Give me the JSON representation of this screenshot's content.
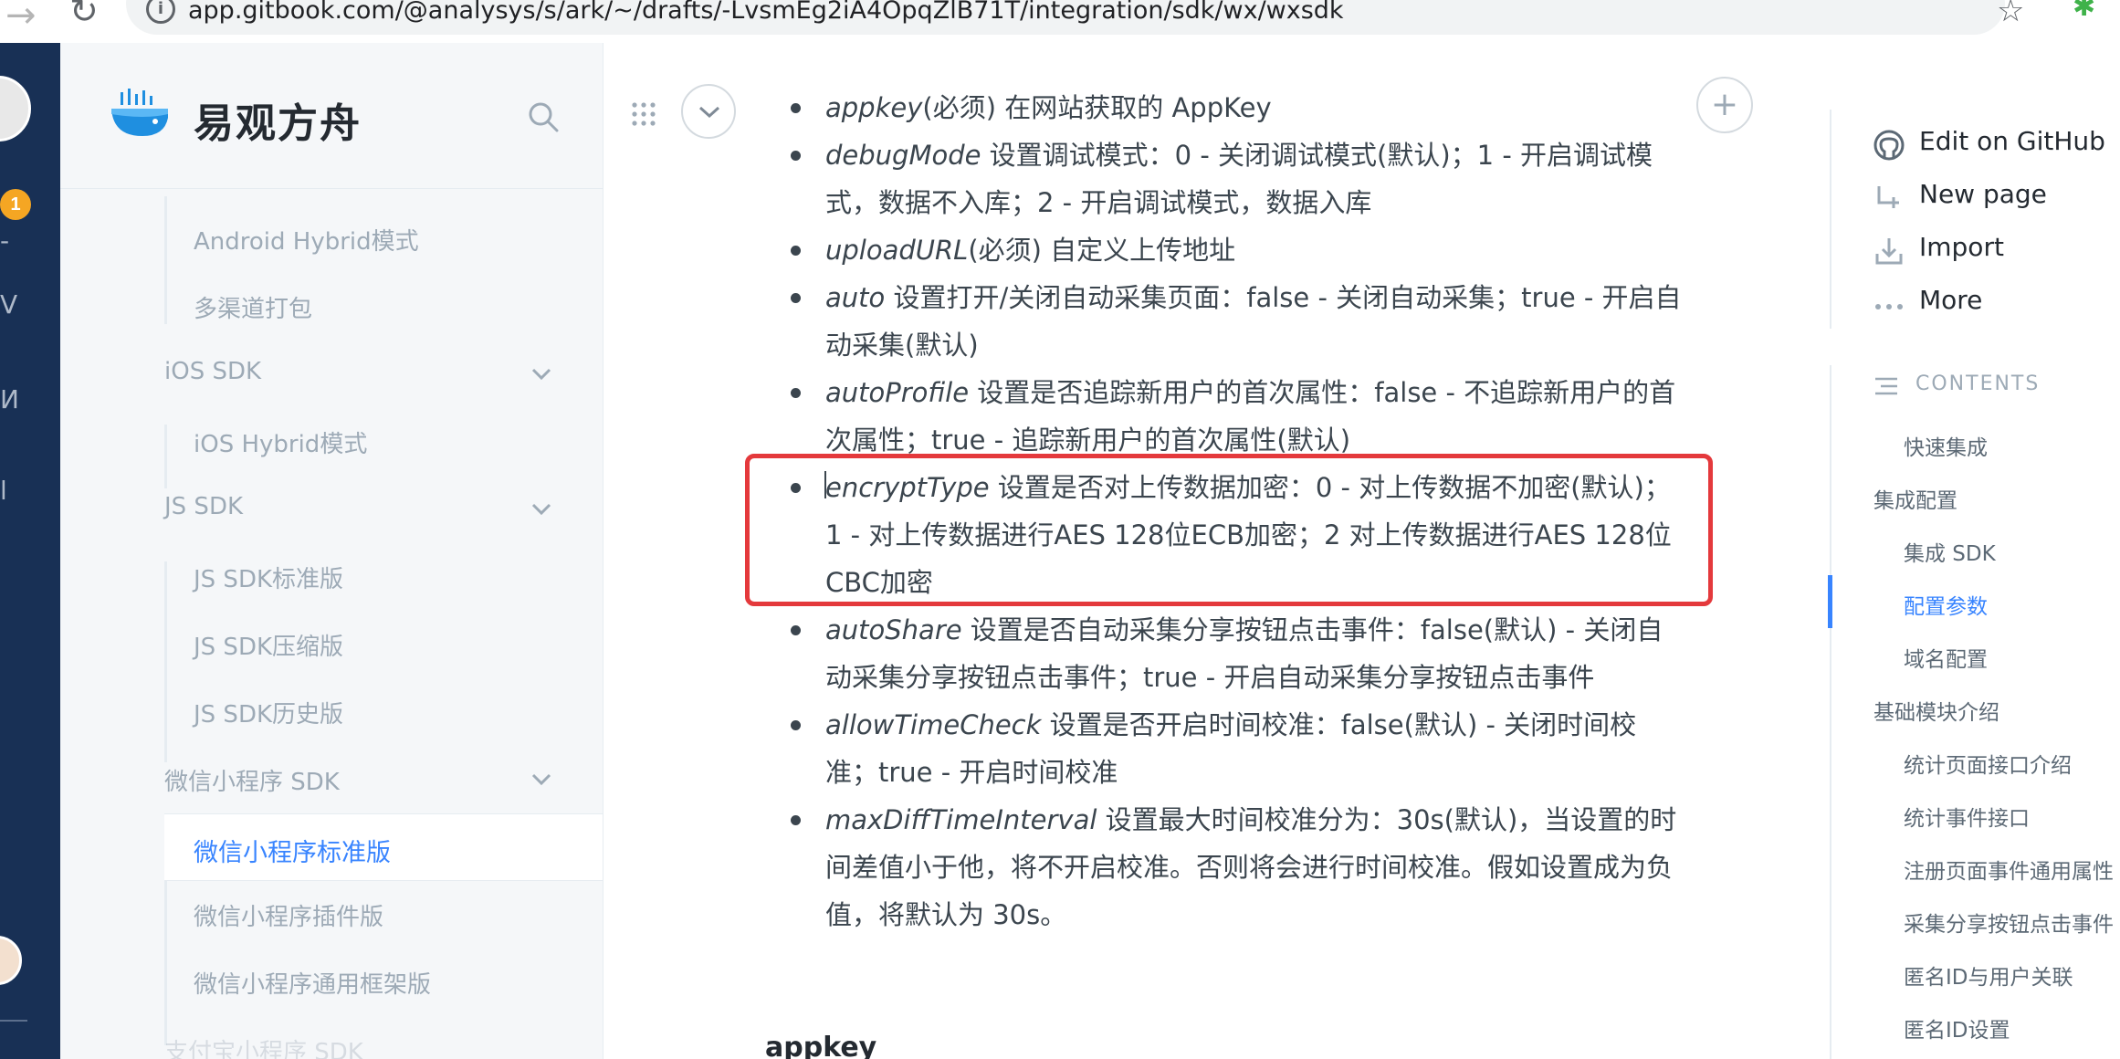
{
  "browser": {
    "url": "app.gitbook.com/@analysys/s/ark/~/drafts/-LvsmEg2iA4OpqZlB71T/integration/sdk/wx/wxsdk"
  },
  "rail": {
    "badge": "1",
    "letters": [
      "-",
      "V",
      "И",
      "l"
    ]
  },
  "sidebar": {
    "brand": "易观方舟",
    "items": [
      {
        "label": "Android Hybrid模式",
        "level": 2
      },
      {
        "label": "多渠道打包",
        "level": 2
      },
      {
        "label": "iOS SDK",
        "level": 1,
        "expandable": true
      },
      {
        "label": "iOS Hybrid模式",
        "level": 2
      },
      {
        "label": "JS SDK",
        "level": 1,
        "expandable": true
      },
      {
        "label": "JS SDK标准版",
        "level": 2
      },
      {
        "label": "JS SDK压缩版",
        "level": 2
      },
      {
        "label": "JS SDK历史版",
        "level": 2
      },
      {
        "label": "微信小程序 SDK",
        "level": 1,
        "expandable": true
      },
      {
        "label": "微信小程序标准版",
        "level": 2,
        "active": true
      },
      {
        "label": "微信小程序插件版",
        "level": 2
      },
      {
        "label": "微信小程序通用框架版",
        "level": 2
      },
      {
        "label": "支付宝小程序 SDK",
        "level": 1
      }
    ]
  },
  "content": {
    "bullets": [
      {
        "term": "appkey",
        "text": "(必须) 在网站获取的 AppKey"
      },
      {
        "term": "debugMode",
        "text": " 设置调试模式：0 - 关闭调试模式(默认)；1 - 开启调试模式，数据不入库；2 - 开启调试模式，数据入库"
      },
      {
        "term": "uploadURL",
        "text": "(必须) 自定义上传地址"
      },
      {
        "term": "auto",
        "text": " 设置打开/关闭自动采集页面：false - 关闭自动采集；true - 开启自动采集(默认)"
      },
      {
        "term": "autoProfile",
        "text": " 设置是否追踪新用户的首次属性：false - 不追踪新用户的首次属性；true - 追踪新用户的首次属性(默认)"
      },
      {
        "term": "encryptType",
        "text": " 设置是否对上传数据加密：0 - 对上传数据不加密(默认)；1 - 对上传数据进行AES 128位ECB加密；2 对上传数据进行AES 128位CBC加密"
      },
      {
        "term": "autoShare",
        "text": " 设置是否自动采集分享按钮点击事件：false(默认) - 关闭自动采集分享按钮点击事件；true - 开启自动采集分享按钮点击事件"
      },
      {
        "term": "allowTimeCheck",
        "text": " 设置是否开启时间校准：false(默认) - 关闭时间校准；true - 开启时间校准"
      },
      {
        "term": "maxDiffTimeInterval",
        "text": " 设置最大时间校准分为：30s(默认)，当设置的时间差值小于他，将不开启校准。否则将会进行时间校准。假如设置成为负值，将默认为 30s。"
      }
    ],
    "next_heading": "appkey"
  },
  "right_panel": {
    "actions": [
      {
        "label": "Edit on GitHub",
        "icon": "github-icon"
      },
      {
        "label": "New page",
        "icon": "new-page-icon"
      },
      {
        "label": "Import",
        "icon": "import-icon"
      },
      {
        "label": "More",
        "icon": "more-icon"
      }
    ],
    "contents_heading": "CONTENTS",
    "toc": [
      {
        "label": "快速集成",
        "level": 2
      },
      {
        "label": "集成配置",
        "level": 1
      },
      {
        "label": "集成 SDK",
        "level": 2
      },
      {
        "label": "配置参数",
        "level": 2,
        "active": true
      },
      {
        "label": "域名配置",
        "level": 2
      },
      {
        "label": "基础模块介绍",
        "level": 1
      },
      {
        "label": "统计页面接口介绍",
        "level": 2
      },
      {
        "label": "统计事件接口",
        "level": 2
      },
      {
        "label": "注册页面事件通用属性",
        "level": 2
      },
      {
        "label": "采集分享按钮点击事件",
        "level": 2
      },
      {
        "label": "匿名ID与用户关联",
        "level": 2
      },
      {
        "label": "匿名ID设置",
        "level": 2
      }
    ]
  },
  "colors": {
    "accent": "#3884ff",
    "rail": "#183055",
    "highlight": "#e4393c"
  }
}
